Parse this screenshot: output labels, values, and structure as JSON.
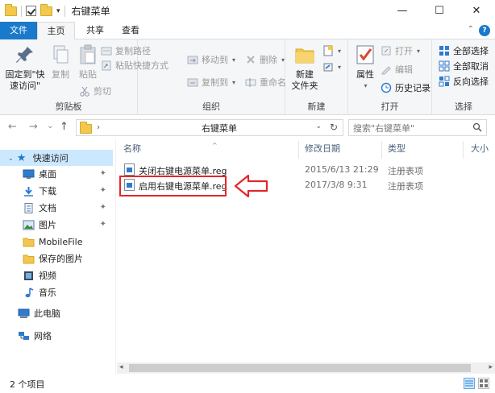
{
  "window": {
    "title": "右键菜单",
    "qa_drop": "▾",
    "controls": {
      "minimize": "—",
      "maximize": "☐",
      "close": "✕"
    }
  },
  "ribbon_tabs": {
    "file": "文件",
    "home": "主页",
    "share": "共享",
    "view": "查看",
    "collapse": "⌃",
    "help": "?"
  },
  "ribbon": {
    "clipboard": {
      "label": "剪贴板",
      "pin_line1": "固定到\"快",
      "pin_line2": "速访问\"",
      "copy": "复制",
      "paste": "粘贴",
      "copy_path": "复制路径",
      "paste_shortcut": "粘贴快捷方式",
      "cut": "剪切"
    },
    "organize": {
      "label": "组织",
      "move_to": "移动到",
      "copy_to": "复制到",
      "delete": "删除",
      "rename": "重命名"
    },
    "new": {
      "label": "新建",
      "new_folder_line1": "新建",
      "new_folder_line2": "文件夹"
    },
    "open": {
      "label": "打开",
      "properties": "属性",
      "open": "打开",
      "edit": "编辑",
      "history": "历史记录"
    },
    "select": {
      "label": "选择",
      "select_all": "全部选择",
      "select_none": "全部取消",
      "invert": "反向选择"
    }
  },
  "navbar": {
    "back": "←",
    "forward": "→",
    "recent": "⌄",
    "up": "↑",
    "chevron": "›",
    "path": "右键菜单",
    "drop": "⌄",
    "refresh": "↻",
    "search_placeholder": "搜索\"右键菜单\""
  },
  "nav_pane": {
    "quick_access": "快速访问",
    "items": [
      {
        "label": "桌面",
        "icon": "desktop-icon"
      },
      {
        "label": "下载",
        "icon": "download-icon"
      },
      {
        "label": "文档",
        "icon": "document-icon"
      },
      {
        "label": "图片",
        "icon": "pictures-icon"
      },
      {
        "label": "MobileFile",
        "icon": "folder-icon"
      },
      {
        "label": "保存的图片",
        "icon": "folder-icon"
      },
      {
        "label": "视频",
        "icon": "video-icon"
      },
      {
        "label": "音乐",
        "icon": "music-icon"
      }
    ],
    "this_pc": "此电脑",
    "network": "网络",
    "pin_glyph": "📌"
  },
  "file_list": {
    "columns": {
      "name": "名称",
      "modified": "修改日期",
      "type": "类型",
      "size": "大小"
    },
    "sort_glyph": "^",
    "rows": [
      {
        "name": "关闭右键电源菜单.reg",
        "modified": "2015/6/13 21:29",
        "type": "注册表项"
      },
      {
        "name": "启用右键电源菜单.reg",
        "modified": "2017/3/8 9:31",
        "type": "注册表项"
      }
    ]
  },
  "scrollbar": {
    "left": "◂",
    "right": "▸"
  },
  "status": {
    "item_count": "2 个项目"
  },
  "colors": {
    "accent": "#1979ca",
    "selection": "#cce8ff",
    "highlight_box": "#e3262a"
  }
}
